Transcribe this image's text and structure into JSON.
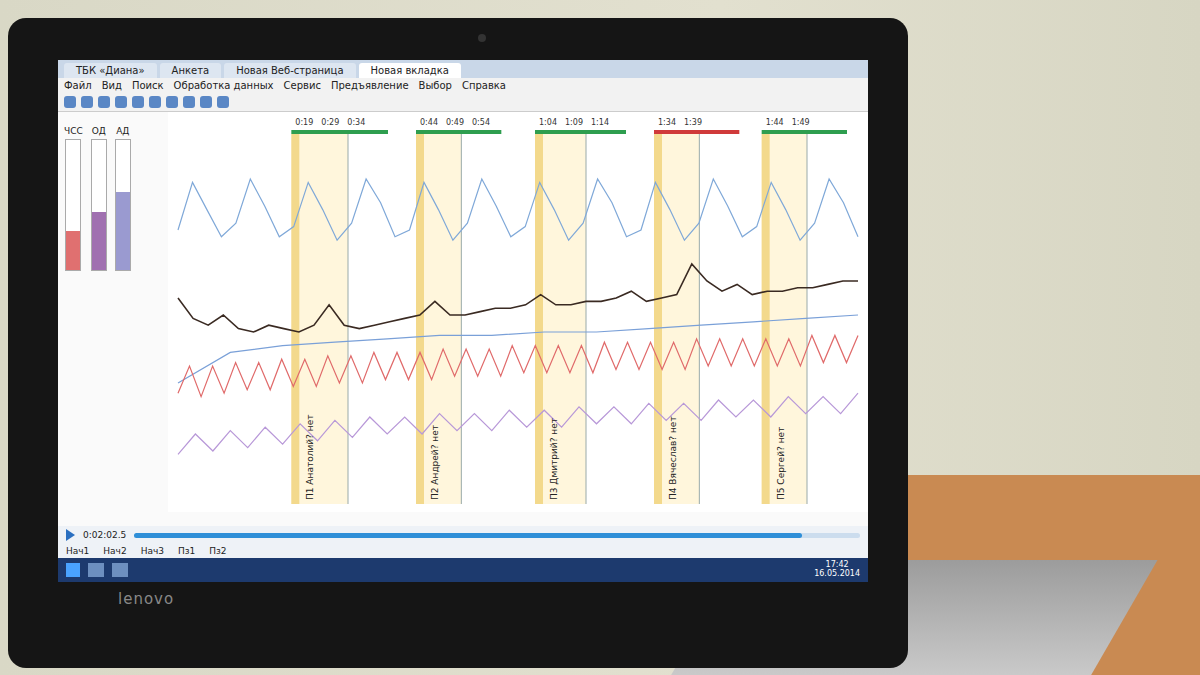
{
  "tabs": [
    {
      "label": "ТБК «Диана»",
      "selected": false
    },
    {
      "label": "Анкета",
      "selected": false
    },
    {
      "label": "Новая Веб-страница",
      "selected": false
    },
    {
      "label": "Новая вкладка",
      "selected": true
    }
  ],
  "menu": [
    "Файл",
    "Вид",
    "Поиск",
    "Обработка данных",
    "Сервис",
    "Предъявление",
    "Выбор",
    "Справка"
  ],
  "gauges": [
    {
      "label": "ЧСС",
      "level": 0.3,
      "color": "#e07070"
    },
    {
      "label": "ОД",
      "level": 0.45,
      "color": "#a070b0"
    },
    {
      "label": "АД",
      "level": 0.6,
      "color": "#9a9ad0"
    }
  ],
  "chart": {
    "x_max": 120,
    "series": [
      {
        "name": "pulse",
        "color": "#7fa8d8",
        "values": [
          80,
          94,
          86,
          78,
          82,
          95,
          87,
          78,
          81,
          94,
          86,
          77,
          82,
          95,
          88,
          78,
          80,
          94,
          86,
          77,
          82,
          95,
          87,
          78,
          81,
          94,
          86,
          77,
          82,
          95,
          88,
          78,
          80,
          94,
          86,
          77,
          82,
          95,
          87,
          78,
          81,
          94,
          86,
          77,
          82,
          95,
          88,
          78
        ]
      },
      {
        "name": "gsr",
        "color": "#3a2a22",
        "values": [
          60,
          54,
          52,
          55,
          51,
          50,
          52,
          51,
          50,
          52,
          58,
          52,
          51,
          52,
          53,
          54,
          55,
          59,
          55,
          55,
          56,
          57,
          57,
          58,
          61,
          58,
          58,
          59,
          59,
          60,
          62,
          59,
          60,
          61,
          70,
          65,
          62,
          64,
          61,
          62,
          62,
          63,
          63,
          64,
          65,
          65
        ]
      },
      {
        "name": "baseline",
        "color": "#7aa0d8",
        "values": [
          35,
          44,
          46,
          47,
          48,
          49,
          49,
          50,
          50,
          51,
          52,
          53,
          54,
          55
        ]
      },
      {
        "name": "pressure",
        "color": "#e06a6a",
        "values": [
          32,
          40,
          31,
          40,
          32,
          41,
          33,
          41,
          33,
          42,
          34,
          42,
          34,
          43,
          35,
          43,
          35,
          44,
          36,
          44,
          36,
          44,
          36,
          45,
          37,
          45,
          37,
          45,
          37,
          46,
          38,
          46,
          38,
          46,
          38,
          46,
          38,
          47,
          39,
          47,
          39,
          47,
          39,
          47,
          39,
          48,
          40,
          48,
          40,
          48,
          40,
          48,
          40,
          48,
          40,
          49,
          41,
          49,
          41,
          49
        ]
      },
      {
        "name": "respiration",
        "color": "#b898d8",
        "values": [
          14,
          20,
          15,
          21,
          16,
          22,
          17,
          23,
          18,
          24,
          19,
          25,
          20,
          25,
          20,
          26,
          21,
          26,
          21,
          27,
          22,
          27,
          22,
          28,
          23,
          28,
          23,
          29,
          24,
          29,
          24,
          30,
          25,
          30,
          25,
          31,
          26,
          31,
          26,
          32
        ]
      }
    ]
  },
  "questions": [
    {
      "label": "П1 Анатолий? нет",
      "at": 20,
      "end": 30,
      "times": [
        "0:19",
        "0:29",
        "0:34"
      ],
      "color": "#2e9e4f"
    },
    {
      "label": "П2 Андрей? нет",
      "at": 42,
      "end": 50,
      "times": [
        "0:44",
        "0:49",
        "0:54"
      ],
      "color": "#2e9e4f"
    },
    {
      "label": "П3 Дмитрий? нет",
      "at": 63,
      "end": 72,
      "times": [
        "1:04",
        "1:09",
        "1:14"
      ],
      "color": "#2e9e4f"
    },
    {
      "label": "П4 Вячеслав? нет",
      "at": 84,
      "end": 92,
      "times": [
        "1:34",
        "1:39"
      ],
      "color": "#d03a3a"
    },
    {
      "label": "П5 Сергей? нет",
      "at": 103,
      "end": 111,
      "times": [
        "1:44",
        "1:49"
      ],
      "color": "#2e9e4f"
    }
  ],
  "playback": {
    "time": "0:02:02.5",
    "level": 0.92,
    "tabs": [
      "Нач1",
      "Нач2",
      "Нач3",
      "Пз1",
      "Пз2"
    ]
  },
  "taskbar": {
    "time": "17:42",
    "date": "16.05.2014"
  },
  "brand": "lenovo"
}
